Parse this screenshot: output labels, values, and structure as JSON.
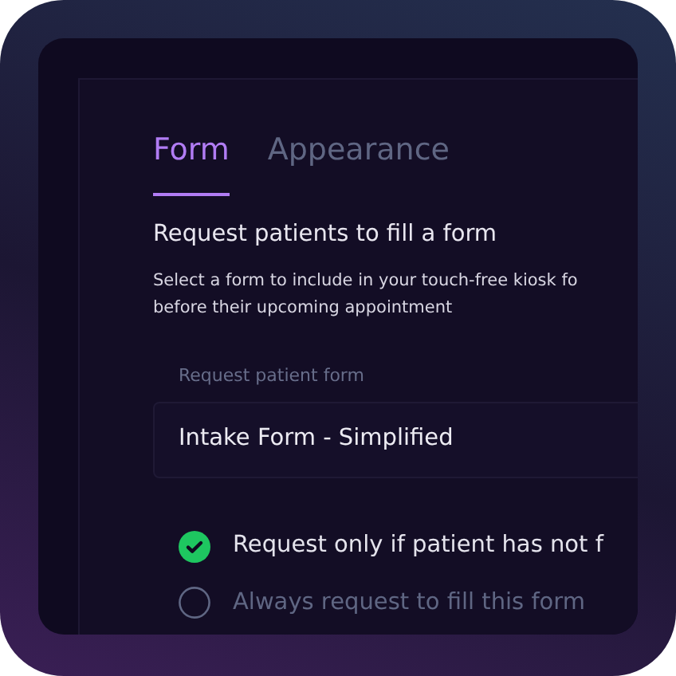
{
  "tabs": [
    {
      "label": "Form",
      "selected": true
    },
    {
      "label": "Appearance",
      "selected": false
    }
  ],
  "section": {
    "title": "Request patients to fill a form",
    "description_lines": [
      "Select a form to include in your touch-free kiosk fo",
      "before their upcoming appointment"
    ]
  },
  "field": {
    "label": "Request patient form",
    "value": "Intake Form - Simplified"
  },
  "options": [
    {
      "label": "Request only if patient has not f",
      "checked": true
    },
    {
      "label": "Always request to fill this form",
      "checked": false
    }
  ]
}
